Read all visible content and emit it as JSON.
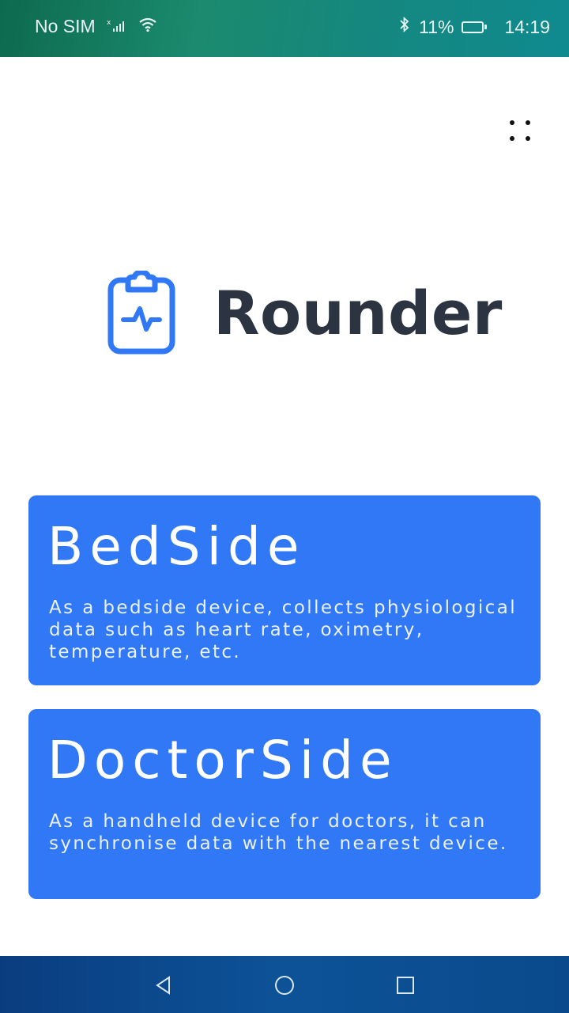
{
  "status_bar": {
    "carrier": "No SIM",
    "battery": "11%",
    "battery_level": 0.11,
    "time": "14:19"
  },
  "app": {
    "title": "Rounder",
    "brand_color": "#3178f6",
    "title_color": "#2d3441"
  },
  "options": [
    {
      "title": "BedSide",
      "description": "As a bedside device, collects physiological data such as heart rate, oximetry, temperature, etc."
    },
    {
      "title": "DoctorSide",
      "description": "As a handheld device for doctors, it can synchronise data with the nearest device."
    }
  ],
  "icons": {
    "logo": "clipboard-pulse-icon",
    "menu": "dots-menu-icon",
    "nav_back": "back-triangle-icon",
    "nav_home": "home-circle-icon",
    "nav_recent": "recent-square-icon"
  }
}
